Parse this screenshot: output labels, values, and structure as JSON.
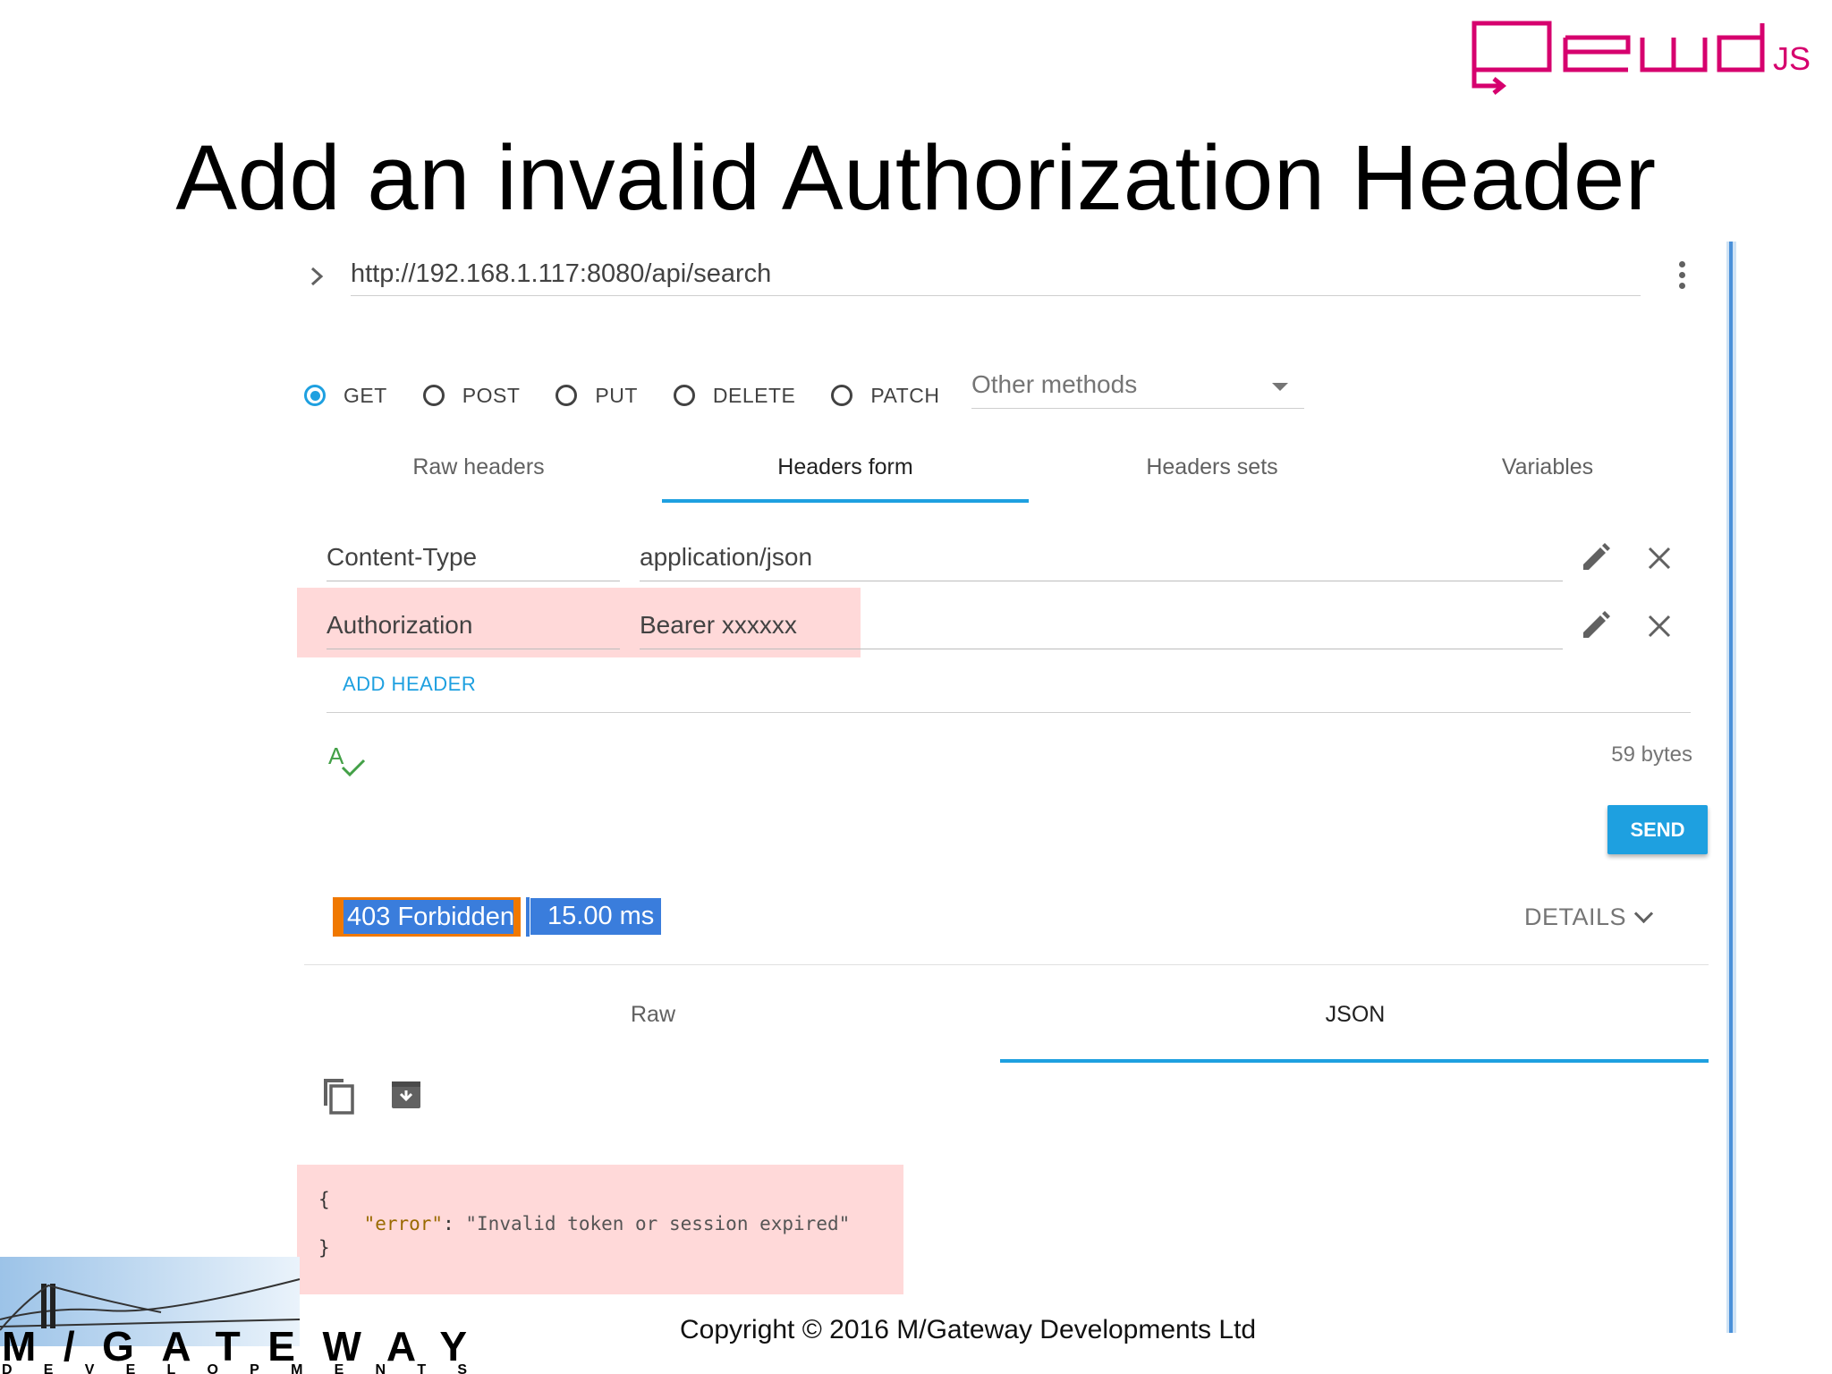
{
  "slide": {
    "title": "Add an invalid Authorization Header",
    "logo_text": "qewd.js",
    "copyright": "Copyright © 2016 M/Gateway Developments Ltd",
    "company_logo": "M/GATEWAY DEVELOPMENTS"
  },
  "request": {
    "url": "http://192.168.1.117:8080/api/search",
    "methods": [
      "GET",
      "POST",
      "PUT",
      "DELETE",
      "PATCH"
    ],
    "selected_method": "GET",
    "other_methods_label": "Other methods"
  },
  "header_tabs": {
    "items": [
      "Raw headers",
      "Headers form",
      "Headers sets",
      "Variables"
    ],
    "active": "Headers form"
  },
  "headers": [
    {
      "name": "Content-Type",
      "value": "application/json"
    },
    {
      "name": "Authorization",
      "value": "Bearer xxxxxx"
    }
  ],
  "add_header_label": "ADD HEADER",
  "body_size": "59 bytes",
  "send_label": "SEND",
  "response": {
    "status": "403 Forbidden",
    "time": "15.00 ms",
    "details_label": "DETAILS",
    "tabs": [
      "Raw",
      "JSON"
    ],
    "active_tab": "JSON",
    "json": {
      "open": "{",
      "key": "\"error\"",
      "sep": ": ",
      "value": "\"Invalid token or session expired\"",
      "close": "}"
    }
  },
  "colors": {
    "accent": "#1ea0e0",
    "status_outline": "#f07800",
    "selection_blue": "#3a7ddc",
    "highlight": "#ffb3b3",
    "logo_magenta": "#d6006e"
  },
  "icons": [
    "chevron-right-icon",
    "more-vert-icon",
    "dropdown-caret-icon",
    "pencil-icon",
    "close-icon",
    "spellcheck-icon",
    "copy-icon",
    "archive-icon",
    "chevron-down-icon"
  ]
}
